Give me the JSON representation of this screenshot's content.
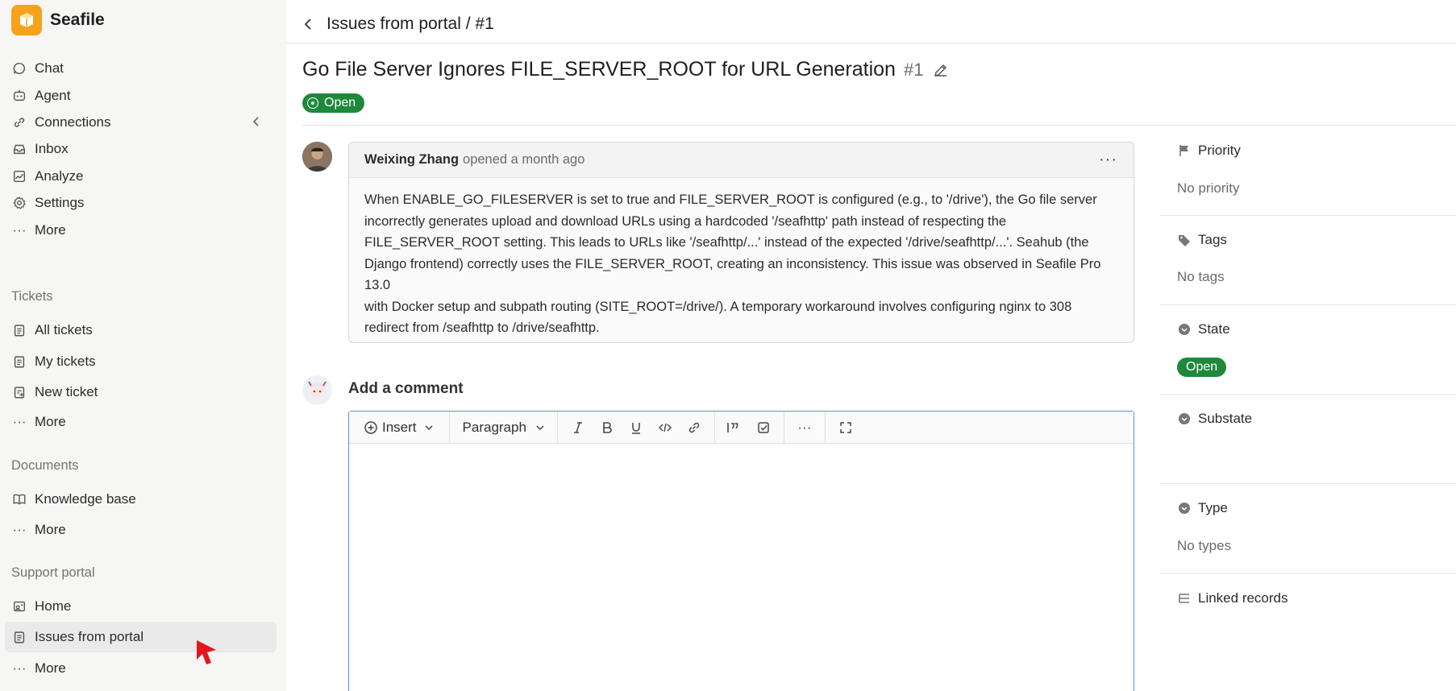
{
  "brand": {
    "name": "Seafile",
    "color": "#f7a21b"
  },
  "sidebar": {
    "main_items": [
      {
        "label": "Chat",
        "icon": "chat-icon"
      },
      {
        "label": "Agent",
        "icon": "agent-icon"
      },
      {
        "label": "Connections",
        "icon": "connections-icon"
      },
      {
        "label": "Inbox",
        "icon": "inbox-icon"
      },
      {
        "label": "Analyze",
        "icon": "analyze-icon"
      },
      {
        "label": "Settings",
        "icon": "gear-icon"
      },
      {
        "label": "More",
        "icon": "more-icon"
      }
    ],
    "tickets": {
      "label": "Tickets",
      "items": [
        {
          "label": "All tickets",
          "icon": "clipboard-icon"
        },
        {
          "label": "My tickets",
          "icon": "clipboard-icon"
        },
        {
          "label": "New ticket",
          "icon": "clipboard-plus-icon"
        },
        {
          "label": "More",
          "icon": "more-icon"
        }
      ]
    },
    "documents": {
      "label": "Documents",
      "items": [
        {
          "label": "Knowledge base",
          "icon": "book-icon"
        },
        {
          "label": "More",
          "icon": "more-icon"
        }
      ]
    },
    "support_portal": {
      "label": "Support portal",
      "items": [
        {
          "label": "Home",
          "icon": "portal-home-icon"
        },
        {
          "label": "Issues from portal",
          "icon": "clipboard-icon",
          "active": true
        },
        {
          "label": "More",
          "icon": "more-icon"
        }
      ]
    }
  },
  "header": {
    "breadcrumb": "Issues from portal / #1"
  },
  "issue": {
    "title": "Go File Server Ignores FILE_SERVER_ROOT for URL Generation",
    "number": "#1",
    "status": "Open",
    "status_color": "#1f883d"
  },
  "comment": {
    "author": "Weixing Zhang",
    "meta": "opened a month ago",
    "body_lines": [
      "When ENABLE_GO_FILESERVER is set to true and FILE_SERVER_ROOT is configured (e.g., to '/drive'), the Go file server",
      "incorrectly generates upload and download URLs using a hardcoded '/seafhttp' path instead of respecting the",
      "FILE_SERVER_ROOT setting. This leads to URLs like '/seafhttp/...' instead of the expected '/drive/seafhttp/...'. Seahub (the",
      "Django frontend) correctly uses the FILE_SERVER_ROOT, creating an inconsistency. This issue was observed in Seafile Pro 13.0",
      "with Docker setup and subpath routing (SITE_ROOT=/drive/). A temporary workaround involves configuring nginx to 308",
      "redirect from /seafhttp to /drive/seafhttp."
    ]
  },
  "editor": {
    "heading": "Add a comment",
    "insert_label": "Insert",
    "paragraph_label": "Paragraph"
  },
  "side": {
    "priority": {
      "label": "Priority",
      "value": "No priority"
    },
    "tags": {
      "label": "Tags",
      "value": "No tags"
    },
    "state": {
      "label": "State",
      "value": "Open"
    },
    "substate": {
      "label": "Substate",
      "value": ""
    },
    "type": {
      "label": "Type",
      "value": "No types"
    },
    "linked": {
      "label": "Linked records"
    }
  }
}
